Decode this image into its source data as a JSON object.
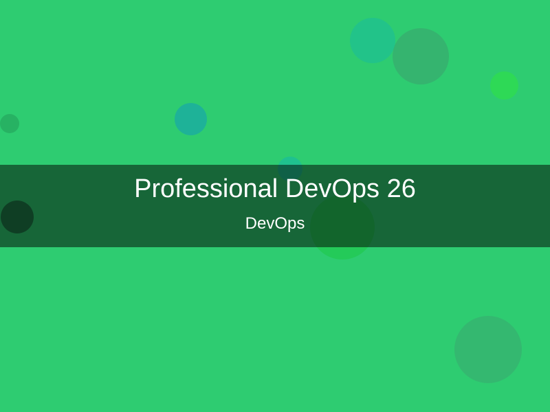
{
  "slide": {
    "title": "Professional DevOps 26",
    "subtitle": "DevOps",
    "background_color": "#2ecc71",
    "banner_color": "rgba(0,0,0,0.5)",
    "text_color": "#ffffff"
  }
}
